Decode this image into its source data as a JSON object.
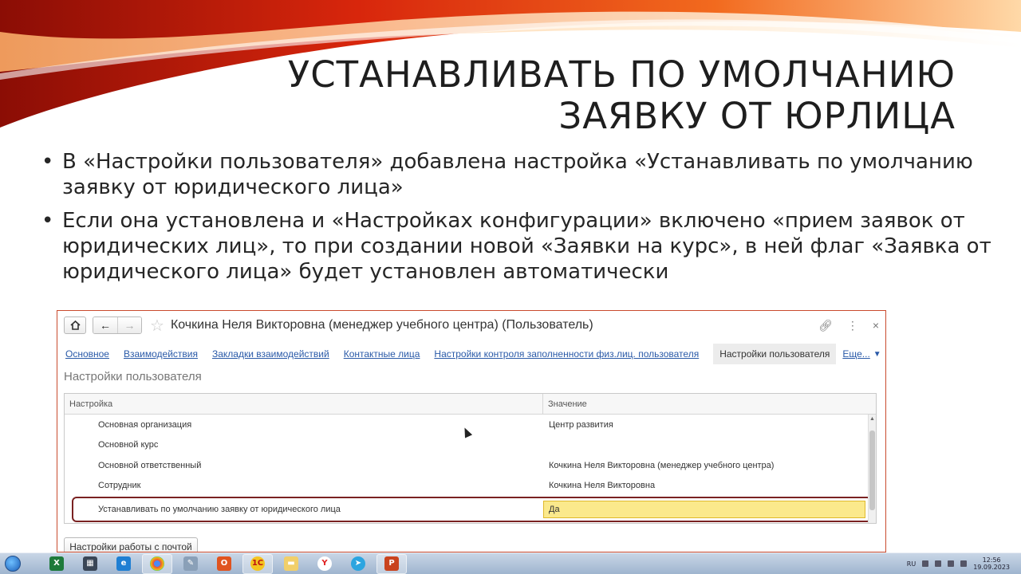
{
  "slide": {
    "title_line1": "Устанавливать по умолчанию",
    "title_line2": "заявку от юрлица",
    "bullets": [
      "В «Настройки пользователя» добавлена настройка «Устанавливать по умолчанию заявку от юридического лица»",
      "Если она установлена и «Настройках конфигурации» включено «прием заявок от юридических лиц», то при создании новой «Заявки на курс», в ней флаг «Заявка от юридического лица» будет установлен автоматически"
    ]
  },
  "window": {
    "title": "Кочкина Неля Викторовна (менеджер учебного центра) (Пользователь)",
    "tabs": [
      "Основное",
      "Взаимодействия",
      "Закладки взаимодействий",
      "Контактные лица",
      "Настройки контроля заполненности физ.лиц. пользователя",
      "Настройки пользователя",
      "Еще..."
    ],
    "active_tab_index": 5,
    "form_title": "Настройки пользователя",
    "table": {
      "columns": [
        "Настройка",
        "Значение"
      ],
      "rows": [
        {
          "setting": "Основная организация",
          "value": "Центр развития"
        },
        {
          "setting": "Основной курс",
          "value": ""
        },
        {
          "setting": "Основной ответственный",
          "value": "Кочкина Неля Викторовна (менеджер учебного центра)"
        },
        {
          "setting": "Сотрудник",
          "value": "Кочкина Неля Викторовна"
        },
        {
          "setting": "Устанавливать по умолчанию заявку от юридического лица",
          "value": "Да"
        }
      ],
      "highlight_color": "#fbe98c"
    },
    "mail_button": "Настройки работы с почтой",
    "icons": [
      "home-icon",
      "back-arrow-icon",
      "forward-arrow-icon",
      "star-icon",
      "link-icon",
      "more-icon",
      "close-icon"
    ]
  },
  "taskbar": {
    "apps": [
      "excel-icon",
      "task-manager-icon",
      "ie-icon",
      "chrome-icon",
      "tool-icon",
      "office-icon",
      "1c-icon",
      "explorer-icon",
      "yandex-icon",
      "telegram-icon",
      "powerpoint-icon"
    ],
    "lang": "RU",
    "time": "12:56",
    "date": "19.09.2023"
  }
}
